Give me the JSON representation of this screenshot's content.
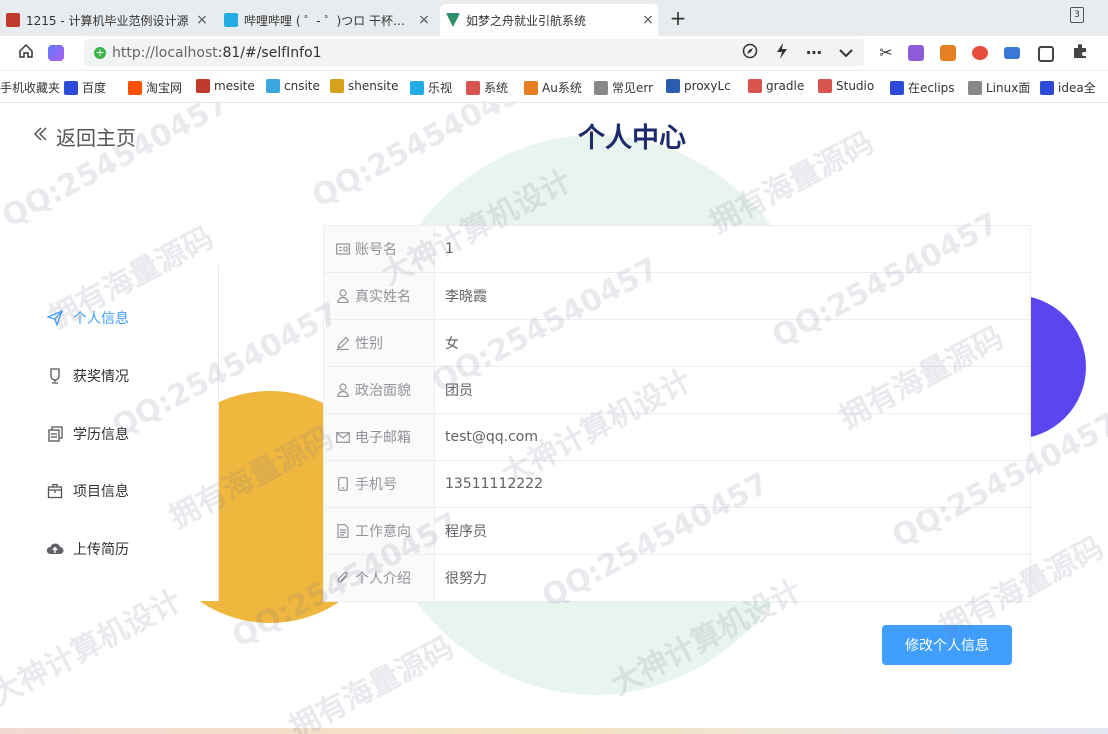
{
  "browser": {
    "tabs": [
      {
        "title": "1215 - 计算机毕业范例设计源",
        "color": "#c0392b",
        "active": false
      },
      {
        "title": "哔哩哔哩 ( ゜- ゜)つロ 干杯~-b",
        "color": "#23ade5",
        "active": false
      },
      {
        "title": "如梦之舟就业引航系统",
        "color": "#2f8f6b",
        "active": true
      }
    ],
    "tab_close": "×",
    "new_tab": "+",
    "tab_count": "3",
    "url_host": "http://localhost",
    "url_rest": ":81/#/selfInfo1",
    "bookmarks": [
      {
        "label": "手机收藏夹",
        "color": "#ffffff"
      },
      {
        "label": "百度",
        "color": "#2e4bd8"
      },
      {
        "label": "淘宝网",
        "color": "#ff5000"
      },
      {
        "label": "mesite",
        "color": "#c0392b"
      },
      {
        "label": "cnsite",
        "color": "#3aa7e0"
      },
      {
        "label": "shensite",
        "color": "#d6a21c"
      },
      {
        "label": "乐视",
        "color": "#23ade5"
      },
      {
        "label": "系统",
        "color": "#d9534f"
      },
      {
        "label": "Au系统",
        "color": "#e67e22"
      },
      {
        "label": "常见err",
        "color": "#888888"
      },
      {
        "label": "proxyLc",
        "color": "#2a5db0"
      },
      {
        "label": "gradle",
        "color": "#d9534f"
      },
      {
        "label": "Studio",
        "color": "#d9534f"
      },
      {
        "label": "在eclips",
        "color": "#2e4bd8"
      },
      {
        "label": "Linux面",
        "color": "#888888"
      },
      {
        "label": "idea全",
        "color": "#2e4bd8"
      }
    ]
  },
  "page": {
    "back_label": "返回主页",
    "title": "个人中心",
    "menu": [
      {
        "label": "个人信息",
        "icon": "paper-plane-icon",
        "active": true
      },
      {
        "label": "获奖情况",
        "icon": "trophy-icon",
        "active": false
      },
      {
        "label": "学历信息",
        "icon": "document-copy-icon",
        "active": false
      },
      {
        "label": "项目信息",
        "icon": "box-icon",
        "active": false
      },
      {
        "label": "上传简历",
        "icon": "cloud-upload-icon",
        "active": false
      }
    ],
    "fields": [
      {
        "label": "账号名",
        "value": "1",
        "icon": "id-card-icon"
      },
      {
        "label": "真实姓名",
        "value": "李晓霞",
        "icon": "user-icon"
      },
      {
        "label": "性别",
        "value": "女",
        "icon": "edit-pen-icon"
      },
      {
        "label": "政治面貌",
        "value": "团员",
        "icon": "user-icon"
      },
      {
        "label": "电子邮箱",
        "value": "test@qq.com",
        "icon": "mail-icon"
      },
      {
        "label": "手机号",
        "value": "13511112222",
        "icon": "mobile-icon"
      },
      {
        "label": "工作意向",
        "value": "程序员",
        "icon": "document-icon"
      },
      {
        "label": "个人介绍",
        "value": "很努力",
        "icon": "paperclip-icon"
      }
    ],
    "edit_button": "修改个人信息",
    "watermarks": [
      "QQ:254540457",
      "拥有海量源码",
      "大神计算机设计"
    ],
    "colors": {
      "accent": "#409eff",
      "title": "#1d2a6b",
      "yellow": "#efb73e",
      "purple": "#5b45f0",
      "green_bg": "#e8f5ee"
    }
  }
}
